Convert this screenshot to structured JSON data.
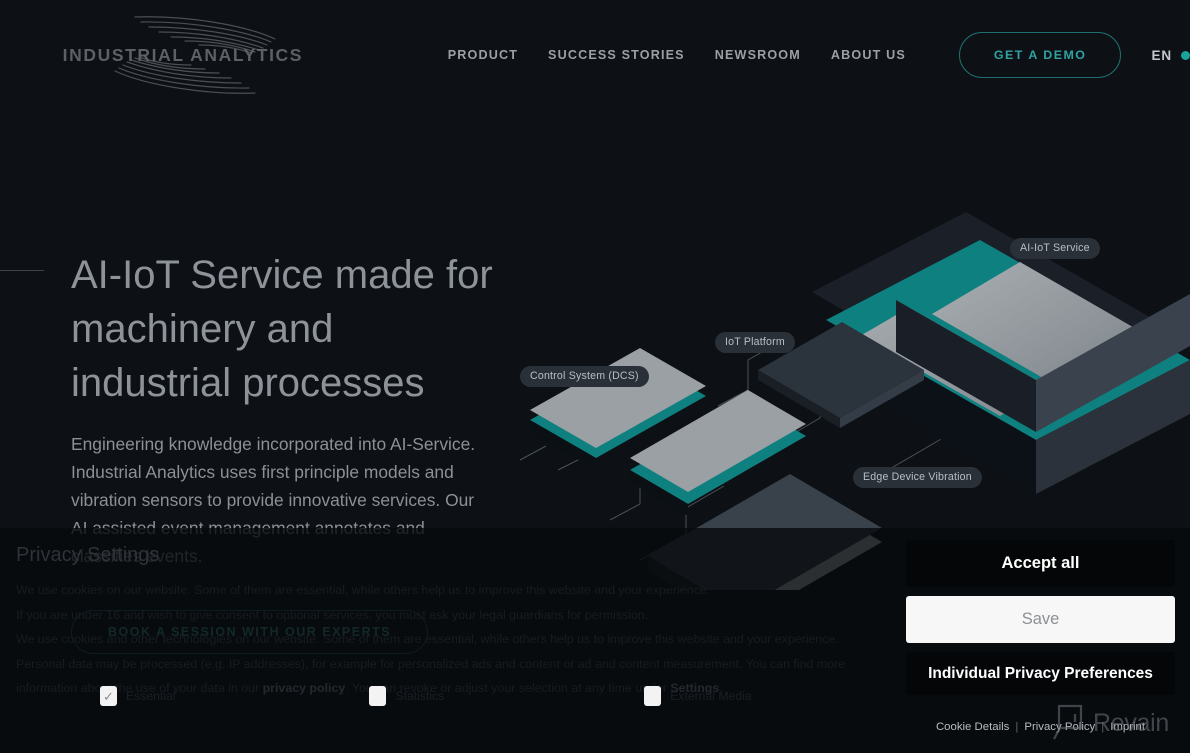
{
  "header": {
    "logo_text": "INDUSTRIAL ANALYTICS",
    "logo_icon": "feather-wing-logo",
    "nav": [
      {
        "label": "PRODUCT"
      },
      {
        "label": "SUCCESS STORIES"
      },
      {
        "label": "NEWSROOM"
      },
      {
        "label": "ABOUT US"
      }
    ],
    "demo_button": "GET A DEMO",
    "language": "EN",
    "language_dot_color": "#1aa39b"
  },
  "hero": {
    "title": "AI-IoT Service made for machinery and industrial processes",
    "paragraph": "Engineering knowledge incorporated into AI-Service. Industrial Analytics uses first principle models and vibration sensors to provide innovative services. Our AI assisted event management annotates and classifies events.",
    "cta": "BOOK A SESSION WITH OUR EXPERTS"
  },
  "illustration": {
    "tags": {
      "ai_iot": "AI-IoT Service",
      "iot_platform": "IoT Platform",
      "control_system": "Control System (DCS)",
      "edge_device": "Edge Device Vibration"
    },
    "accent_color": "#0f7f7f"
  },
  "cookie_banner": {
    "heading": "Privacy Settings",
    "body_part1": "We use cookies on our website. Some of them are essential, while others help us to improve this website and your experience.",
    "body_part2": "If you are under 16 and wish to give consent to optional services, you must ask your legal guardians for permission.",
    "body_part3": "We use cookies and other technologies on our website. Some of them are essential, while others help us to improve this website and your experience. Personal data may be processed (e.g. IP addresses), for example for personalized ads and content or ad and content measurement. You can find more information about the use of your data in our ",
    "privacy_policy_link": "privacy policy",
    "body_part4": ". You can revoke or adjust your selection at any time under ",
    "settings_link": "Settings",
    "body_part5": ".",
    "checkboxes": [
      {
        "label": "Essential",
        "checked": true
      },
      {
        "label": "Statistics",
        "checked": false
      },
      {
        "label": "External Media",
        "checked": false
      }
    ],
    "buttons": {
      "accept_all": "Accept all",
      "save": "Save",
      "individual": "Individual Privacy Preferences"
    },
    "links": {
      "cookie_details": "Cookie Details",
      "privacy_policy": "Privacy Policy",
      "imprint": "Imprint",
      "separator": "|"
    }
  },
  "watermark": {
    "text": "Revain",
    "icon": "revain-magnifier-logo"
  }
}
